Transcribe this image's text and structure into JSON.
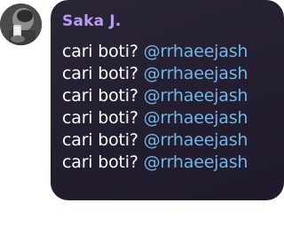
{
  "message": {
    "sender": "Saka J.",
    "lines": [
      {
        "text": "cari boti? ",
        "mention": "@rrhaeejash"
      },
      {
        "text": "cari boti? ",
        "mention": "@rrhaeejash"
      },
      {
        "text": "cari boti? ",
        "mention": "@rrhaeejash"
      },
      {
        "text": "cari boti? ",
        "mention": "@rrhaeejash"
      },
      {
        "text": "cari boti? ",
        "mention": "@rrhaeejash"
      },
      {
        "text": "cari boti? ",
        "mention": "@rrhaeejash"
      }
    ]
  },
  "colors": {
    "bubble": "#231d30",
    "sender": "#b99bf0",
    "text": "#ffffff",
    "mention": "#74b6e6"
  },
  "avatar_icon": "user-photo-icon"
}
